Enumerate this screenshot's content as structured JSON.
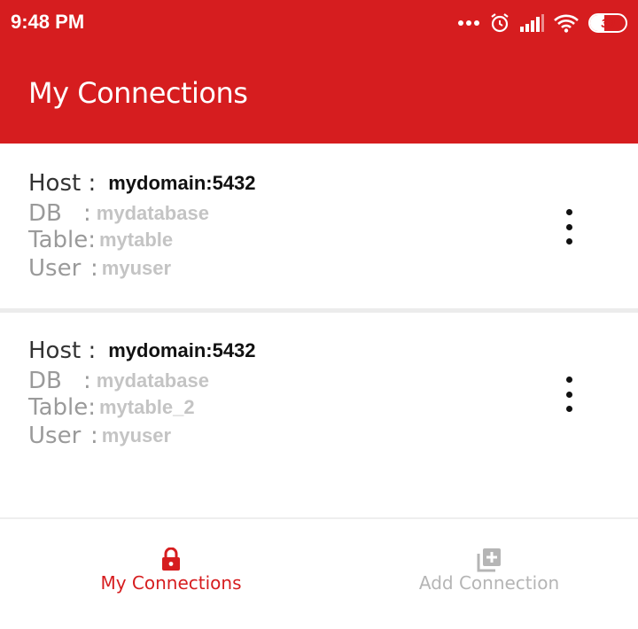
{
  "status_bar": {
    "time": "9:48 PM",
    "battery": "39",
    "battery_level": 0.39,
    "icons": [
      "more-dots-icon",
      "alarm-icon",
      "signal-icon",
      "wifi-icon",
      "battery-icon"
    ]
  },
  "app_bar": {
    "title": "My Connections"
  },
  "connections": [
    {
      "host_label": "Host :",
      "host": "mydomain:5432",
      "db_label": "DB",
      "db_sep": ":",
      "db": "mydatabase",
      "table_label": "Table:",
      "table": "mytable",
      "user_label": "User",
      "user_sep": ":",
      "user": "myuser"
    },
    {
      "host_label": "Host :",
      "host": "mydomain:5432",
      "db_label": "DB",
      "db_sep": ":",
      "db": "mydatabase",
      "table_label": "Table:",
      "table": "mytable_2",
      "user_label": "User",
      "user_sep": ":",
      "user": "myuser"
    }
  ],
  "bottom_nav": {
    "items": [
      {
        "label": "My Connections",
        "icon": "lock-icon",
        "active": true
      },
      {
        "label": "Add Connection",
        "icon": "add-library-icon",
        "active": false
      }
    ]
  },
  "colors": {
    "primary": "#d61d1f",
    "inactive": "#b5b5b5",
    "value_gray": "#c4c4c4"
  }
}
